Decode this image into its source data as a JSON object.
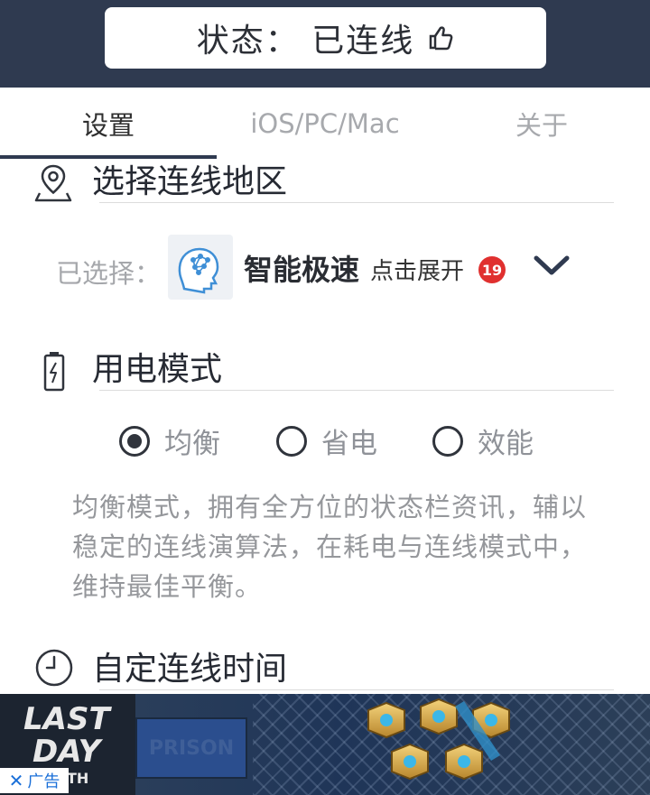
{
  "header": {
    "status_text": "状态： 已连线",
    "icon": "thumbs-up-icon"
  },
  "tabs": [
    {
      "label": "设置",
      "active": true
    },
    {
      "label": "iOS/PC/Mac",
      "active": false
    },
    {
      "label": "关于",
      "active": false
    }
  ],
  "region": {
    "title": "选择连线地区",
    "icon": "location-pin-icon",
    "selected_label": "已选择：",
    "selected_name": "智能极速",
    "expand_hint": "点击展开",
    "badge": "19",
    "chevron_icon": "chevron-down-icon"
  },
  "power": {
    "title": "用电模式",
    "icon": "battery-icon",
    "options": [
      {
        "label": "均衡",
        "selected": true
      },
      {
        "label": "省电",
        "selected": false
      },
      {
        "label": "效能",
        "selected": false
      }
    ],
    "description": "均衡模式，拥有全方位的状态栏资讯，辅以稳定的连线演算法，在耗电与连线模式中，维持最佳平衡。"
  },
  "custom_time": {
    "title": "自定连线时间",
    "icon": "clock-icon"
  },
  "ad": {
    "logo_line1": "LAST",
    "logo_line2": "DAY",
    "logo_line3": "TH",
    "sign_text": "PRISON",
    "tag_text": "广告",
    "close_icon": "close-icon"
  },
  "colors": {
    "header_bg": "#2f3a50",
    "badge": "#e0302f",
    "text_dark": "#262a33",
    "text_muted": "#95979b"
  }
}
